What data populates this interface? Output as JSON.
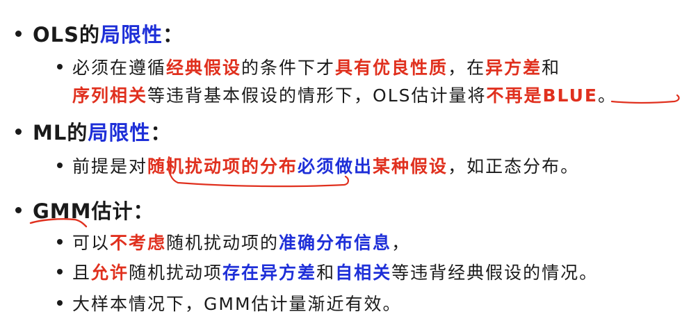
{
  "colors": {
    "text": "#1a1a1a",
    "blue": "#1e2fd8",
    "red": "#e0301e",
    "ink": "#e0301e"
  },
  "sections": [
    {
      "heading": [
        {
          "t": "OLS的",
          "c": "black"
        },
        {
          "t": "局限性",
          "c": "blue"
        },
        {
          "t": "：",
          "c": "black"
        }
      ],
      "lines": [
        [
          {
            "t": "必须在遵循",
            "c": "black"
          },
          {
            "t": "经典假设",
            "c": "red"
          },
          {
            "t": "的条件下才",
            "c": "black"
          },
          {
            "t": "具有优良性质",
            "c": "red"
          },
          {
            "t": "，在",
            "c": "black"
          },
          {
            "t": "异方差",
            "c": "red"
          },
          {
            "t": "和",
            "c": "black"
          }
        ],
        [
          {
            "t": "序列相关",
            "c": "red"
          },
          {
            "t": "等违背基本假设的情形下，OLS估计量将",
            "c": "black"
          },
          {
            "t": "不再是BLUE",
            "c": "red"
          },
          {
            "t": "。",
            "c": "black"
          }
        ]
      ]
    },
    {
      "heading": [
        {
          "t": "ML的",
          "c": "black"
        },
        {
          "t": "局限性",
          "c": "blue"
        },
        {
          "t": "：",
          "c": "black"
        }
      ],
      "lines": [
        [
          {
            "t": "前提是对",
            "c": "black"
          },
          {
            "t": "随机扰动项的分布",
            "c": "red"
          },
          {
            "t": "必须做出",
            "c": "blue"
          },
          {
            "t": "某种假设",
            "c": "red"
          },
          {
            "t": "，如正态分布。",
            "c": "black"
          }
        ]
      ]
    },
    {
      "heading": [
        {
          "t": "GMM估计",
          "c": "black"
        },
        {
          "t": "：",
          "c": "black"
        }
      ],
      "lines": [
        [
          {
            "t": "可以",
            "c": "black"
          },
          {
            "t": "不考虑",
            "c": "red"
          },
          {
            "t": "随机扰动项的",
            "c": "black"
          },
          {
            "t": "准确分布信息",
            "c": "blue"
          },
          {
            "t": "，",
            "c": "black"
          }
        ],
        [
          {
            "t": "且",
            "c": "black"
          },
          {
            "t": "允许",
            "c": "red"
          },
          {
            "t": "随机扰动项",
            "c": "black"
          },
          {
            "t": "存在异方差",
            "c": "blue"
          },
          {
            "t": "和",
            "c": "black"
          },
          {
            "t": "自相关",
            "c": "blue"
          },
          {
            "t": "等违背经典假设的情况。",
            "c": "black"
          }
        ],
        [
          {
            "t": "大样本情况下，GMM估计量渐近有效。",
            "c": "black"
          }
        ]
      ]
    }
  ]
}
